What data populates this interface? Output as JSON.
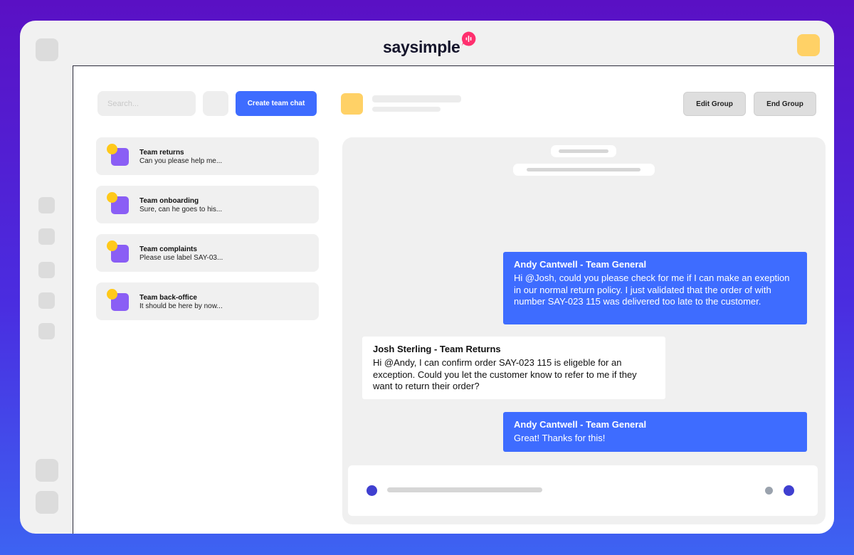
{
  "app": {
    "brand": "saysimple",
    "colors": {
      "accent": "#3e6cff",
      "brand_mark": "#ff2f6e",
      "avatar_yellow": "#ffc91a",
      "team_purple": "#8a5ef5"
    }
  },
  "sidebar": {
    "search_placeholder": "Search...",
    "create_button": "Create team chat",
    "chats": [
      {
        "title": "Team returns",
        "preview": "Can you please help me..."
      },
      {
        "title": "Team onboarding",
        "preview": "Sure, can he goes to his..."
      },
      {
        "title": "Team complaints",
        "preview": "Please use label SAY-03..."
      },
      {
        "title": "Team back-office",
        "preview": "It should be here by now..."
      }
    ]
  },
  "header": {
    "edit_button": "Edit Group",
    "end_button": "End Group"
  },
  "conversation": {
    "messages": [
      {
        "direction": "outgoing",
        "sender": "Andy Cantwell - Team General",
        "text": "Hi @Josh, could you please check for me if I can make an exeption in our normal return policy. I just validated that the order of with number SAY-023 115 was delivered too late to the customer."
      },
      {
        "direction": "incoming",
        "sender": "Josh Sterling - Team Returns",
        "text": "Hi @Andy, I can confirm order SAY-023 115 is eligeble for an exception. Could you let the customer know to refer to me if they want to return their order?"
      },
      {
        "direction": "outgoing",
        "sender": "Andy Cantwell - Team General",
        "text": "Great! Thanks for this!"
      }
    ]
  }
}
